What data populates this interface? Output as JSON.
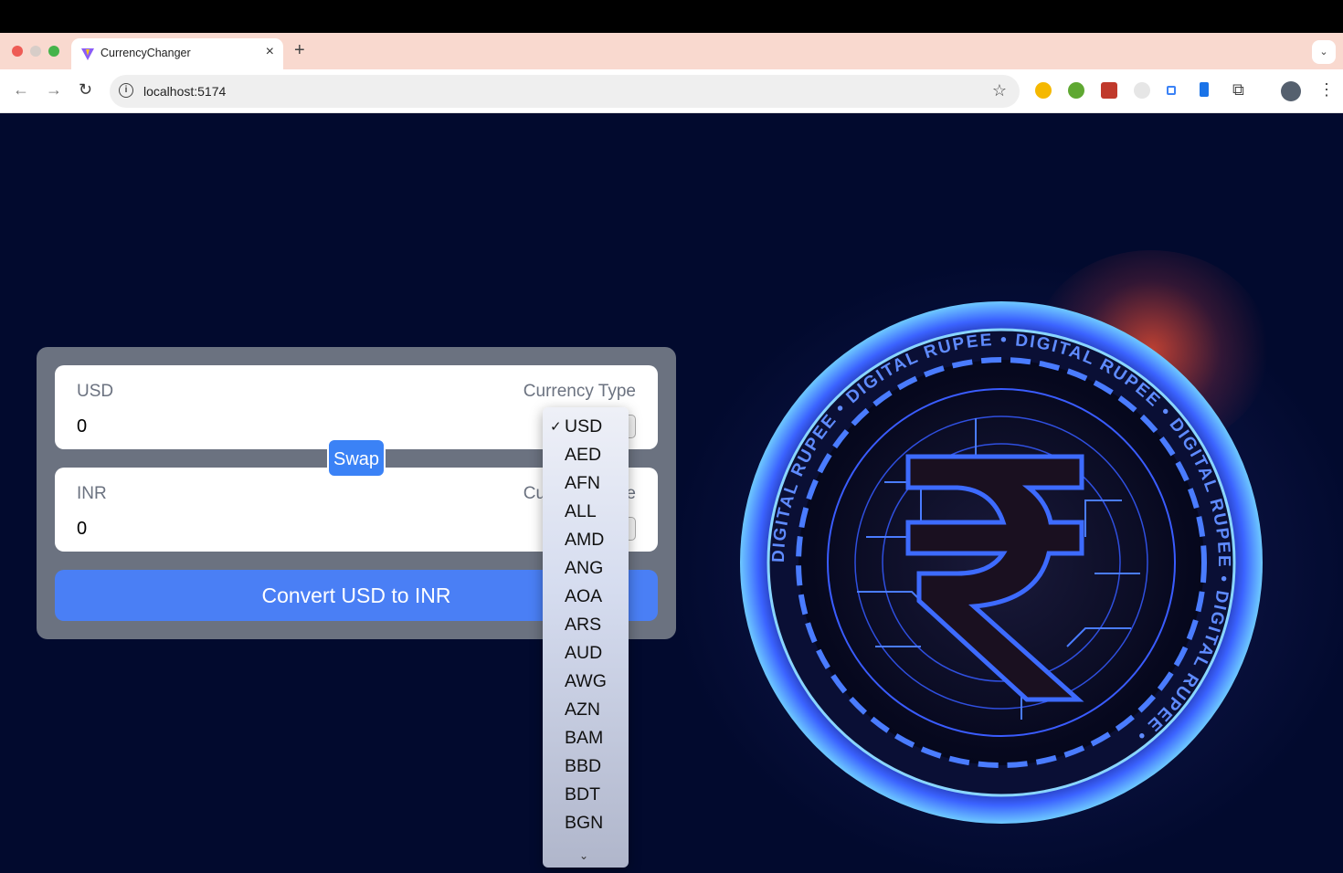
{
  "browser": {
    "tab_title": "CurrencyChanger",
    "url": "localhost:5174"
  },
  "converter": {
    "from": {
      "label": "USD",
      "amount": "0",
      "currency_type_label": "Currency Type"
    },
    "to": {
      "label": "INR",
      "amount": "0",
      "currency_type_label": "Currency Type"
    },
    "swap_label": "Swap",
    "convert_label": "Convert USD to INR"
  },
  "dropdown": {
    "selected": "USD",
    "check": "✓",
    "options": [
      "USD",
      "AED",
      "AFN",
      "ALL",
      "AMD",
      "ANG",
      "AOA",
      "ARS",
      "AUD",
      "AWG",
      "AZN",
      "BAM",
      "BBD",
      "BDT",
      "BGN"
    ]
  },
  "coin_text": "DIGITAL RUPEE",
  "colors": {
    "accent": "#3b82f6",
    "card": "#6b7280",
    "page_bg": "#020a2e"
  }
}
